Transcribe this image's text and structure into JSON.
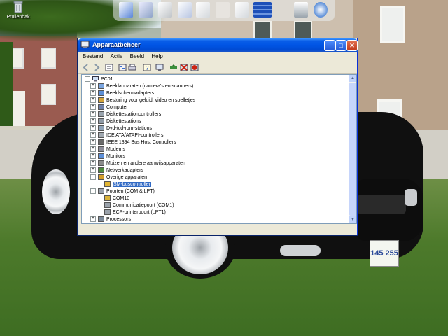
{
  "desktop": {
    "recycle_bin_label": "Prullenbak",
    "license_plate": "145 255"
  },
  "quick_launch": {
    "icons": [
      "monitor-icon",
      "window-icon",
      "disk-icon",
      "folder-icon",
      "file-icon",
      "blank-icon",
      "file-icon",
      "bars-icon",
      "trash-icon",
      "clock-icon"
    ]
  },
  "window": {
    "title": "Apparaatbeheer",
    "title_buttons": {
      "minimize": "_",
      "maximize": "□",
      "close": "✕"
    },
    "menu": [
      "Bestand",
      "Actie",
      "Beeld",
      "Help"
    ],
    "toolbar_icons": [
      "back-icon",
      "forward-icon",
      "properties-icon",
      "tree-view-icon",
      "print-icon",
      "help-icon",
      "scan-hardware-icon",
      "update-driver-icon",
      "disable-icon",
      "uninstall-icon"
    ],
    "tree": {
      "root": "PC01",
      "items": [
        {
          "label": "Beeldapparaten (camera's en scanners)",
          "level": 1,
          "expander": "+"
        },
        {
          "label": "Beeldschermadapters",
          "level": 1,
          "expander": "+"
        },
        {
          "label": "Besturing voor geluid, video en spelletjes",
          "level": 1,
          "expander": "+"
        },
        {
          "label": "Computer",
          "level": 1,
          "expander": "+"
        },
        {
          "label": "Diskettestationcontrollers",
          "level": 1,
          "expander": "+"
        },
        {
          "label": "Diskettestations",
          "level": 1,
          "expander": "+"
        },
        {
          "label": "Dvd-/cd-rom-stations",
          "level": 1,
          "expander": "+"
        },
        {
          "label": "IDE ATA/ATAPI-controllers",
          "level": 1,
          "expander": "+"
        },
        {
          "label": "IEEE 1394 Bus Host Controllers",
          "level": 1,
          "expander": "+"
        },
        {
          "label": "Modems",
          "level": 1,
          "expander": "+"
        },
        {
          "label": "Monitors",
          "level": 1,
          "expander": "+"
        },
        {
          "label": "Muizen en andere aanwijsapparaten",
          "level": 1,
          "expander": "+"
        },
        {
          "label": "Netwerkadapters",
          "level": 1,
          "expander": "+"
        },
        {
          "label": "Overige apparaten",
          "level": 1,
          "expander": "-"
        },
        {
          "label": "SM-buscontroller",
          "level": 2,
          "expander": "",
          "selected": true
        },
        {
          "label": "Poorten (COM & LPT)",
          "level": 1,
          "expander": "-"
        },
        {
          "label": "COM10",
          "level": 2,
          "expander": ""
        },
        {
          "label": "Communicatiepoort (COM1)",
          "level": 2,
          "expander": ""
        },
        {
          "label": "ECP-printerpoort (LPT1)",
          "level": 2,
          "expander": ""
        },
        {
          "label": "Processors",
          "level": 1,
          "expander": "+"
        }
      ]
    }
  },
  "colors": {
    "titlebar": "#0055e5",
    "selection": "#316ac5",
    "window_bg": "#ece9d8"
  }
}
